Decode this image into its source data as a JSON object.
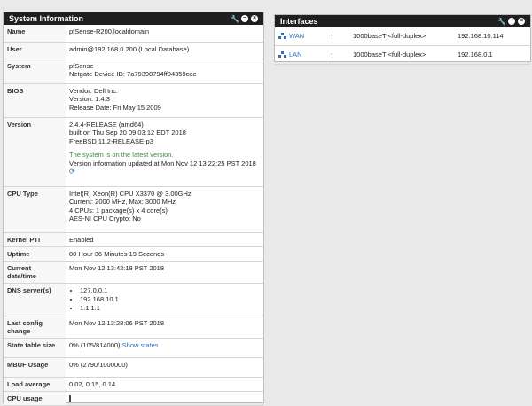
{
  "system_panel": {
    "title": "System Information",
    "rows": {
      "name": {
        "label": "Name",
        "value": "pfSense-R200.localdomain"
      },
      "user": {
        "label": "User",
        "value": "admin@192.168.0.200 (Local Database)"
      },
      "system": {
        "label": "System",
        "line1": "pfSense",
        "line2": "Netgate Device ID: 7a79398794ff04359cae"
      },
      "bios": {
        "label": "BIOS",
        "vendor": "Vendor: Dell Inc.",
        "version": "Version: 1.4.3",
        "release": "Release Date: Fri May 15 2009"
      },
      "version": {
        "label": "Version",
        "line1": "2.4.4-RELEASE (amd64)",
        "line2": "built on Thu Sep 20 09:03:12 EDT 2018",
        "line3": "FreeBSD 11.2-RELEASE-p3",
        "status": "The system is on the latest version.",
        "updated": "Version information updated at Mon Nov 12 13:22:25 PST 2018",
        "refresh_icon": "refresh-icon"
      },
      "cpu": {
        "label": "CPU Type",
        "line1": "Intel(R) Xeon(R) CPU X3370 @ 3.00GHz",
        "line2": "Current: 2000 MHz, Max: 3000 MHz",
        "line3": "4 CPUs: 1 package(s) x 4 core(s)",
        "line4": "AES-NI CPU Crypto: No"
      },
      "kernel_pti": {
        "label": "Kernel PTI",
        "value": "Enabled"
      },
      "uptime": {
        "label": "Uptime",
        "value": "00 Hour 36 Minutes 19 Seconds"
      },
      "datetime": {
        "label": "Current date/time",
        "value": "Mon Nov 12 13:42:18 PST 2018"
      },
      "dns": {
        "label": "DNS server(s)",
        "servers": [
          "127.0.0.1",
          "192.168.10.1",
          "1.1.1.1"
        ]
      },
      "last_config": {
        "label": "Last config change",
        "value": "Mon Nov 12 13:28:06 PST 2018"
      },
      "state_table": {
        "label": "State table size",
        "value": "0% (105/814000)",
        "link": "Show states"
      },
      "mbuf": {
        "label": "MBUF Usage",
        "value": "0% (2790/1000000)"
      },
      "load": {
        "label": "Load average",
        "value": "0.02, 0.15, 0.14"
      },
      "cpu_usage": {
        "label": "CPU usage"
      }
    }
  },
  "interfaces_panel": {
    "title": "Interfaces",
    "rows": [
      {
        "name": "WAN",
        "media": "1000baseT <full-duplex>",
        "ip": "192.168.10.114"
      },
      {
        "name": "LAN",
        "media": "1000baseT <full-duplex>",
        "ip": "192.168.0.1"
      }
    ]
  },
  "colors": {
    "accent": "#2d6fb7",
    "header": "#1f1f1f",
    "status_ok": "#3c8d3c"
  }
}
